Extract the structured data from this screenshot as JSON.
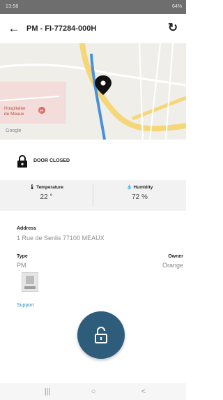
{
  "status_bar": {
    "time": "13:58",
    "right_indicators": "64%"
  },
  "app_bar": {
    "title": "PM - FI-77284-000H",
    "back_icon": "arrow-left-icon",
    "refresh_icon": "refresh-icon"
  },
  "map": {
    "poi_label_line1": "Hospitalier",
    "poi_label_line2": "de Meaux",
    "attribution": "Google"
  },
  "door": {
    "status": "DOOR CLOSED",
    "icon": "lock-icon"
  },
  "sensors": {
    "temperature": {
      "label": "Temperature",
      "value": "22 °",
      "icon": "thermometer-icon"
    },
    "humidity": {
      "label": "Humidity",
      "value": "72 %",
      "icon": "water-drop-icon"
    }
  },
  "details": {
    "address_label": "Address",
    "address_value": "1 Rue de Senlis 77100 MEAUX",
    "type_label": "Type",
    "type_value": "PM",
    "owner_label": "Owner",
    "owner_value": "Orange"
  },
  "support_link": "Support",
  "fab": {
    "icon": "unlock-icon"
  },
  "nav_bar": {
    "recents": "|||",
    "home": "○",
    "back": "<"
  },
  "colors": {
    "accent": "#2e5d7b",
    "link": "#2b8fb8",
    "map_road": "#f5d77a",
    "map_river": "#4a90d9"
  }
}
